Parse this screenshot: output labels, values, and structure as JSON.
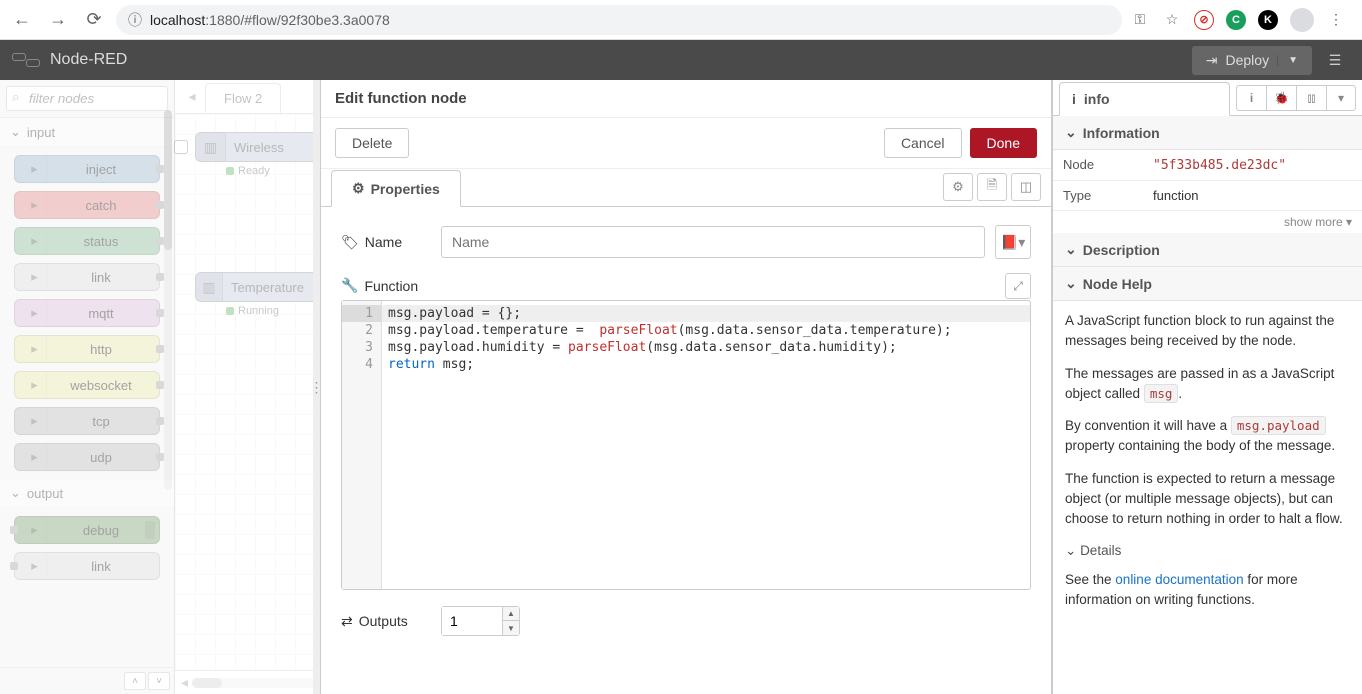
{
  "browser": {
    "url_prefix": "ⓘ",
    "url_host": "localhost",
    "url_port": ":1880",
    "url_path": "/#flow/92f30be3.3a0078",
    "key_icon": "⚿",
    "star_icon": "☆"
  },
  "header": {
    "app_name": "Node-RED",
    "deploy_label": "Deploy"
  },
  "palette": {
    "filter_placeholder": "filter nodes",
    "cat_input": "input",
    "cat_output": "output",
    "nodes_input": [
      {
        "label": "inject",
        "cls": "pn-inject"
      },
      {
        "label": "catch",
        "cls": "pn-catch"
      },
      {
        "label": "status",
        "cls": "pn-status"
      },
      {
        "label": "link",
        "cls": "pn-link"
      },
      {
        "label": "mqtt",
        "cls": "pn-mqtt"
      },
      {
        "label": "http",
        "cls": "pn-http"
      },
      {
        "label": "websocket",
        "cls": "pn-ws"
      },
      {
        "label": "tcp",
        "cls": "pn-tcp"
      },
      {
        "label": "udp",
        "cls": "pn-udp"
      }
    ],
    "nodes_output": [
      {
        "label": "debug",
        "cls": "pn-debug"
      },
      {
        "label": "link",
        "cls": "pn-link"
      }
    ]
  },
  "workspace": {
    "tab_label": "Flow 2",
    "node1_label": "Wireless",
    "node1_status": "Ready",
    "node2_label": "Temperature",
    "node2_status": "Running"
  },
  "editor": {
    "title": "Edit function node",
    "delete_btn": "Delete",
    "cancel_btn": "Cancel",
    "done_btn": "Done",
    "properties_tab": "Properties",
    "name_label": "Name",
    "name_placeholder": "Name",
    "function_label": "Function",
    "outputs_label": "Outputs",
    "outputs_value": "1",
    "code": {
      "lines": [
        "1",
        "2",
        "3",
        "4"
      ],
      "l1a": "msg.payload = {};",
      "l2a": "msg.payload.temperature =  ",
      "l2b": "parseFloat",
      "l2c": "(msg.data.sensor_data.temperature);",
      "l3a": "msg.payload.humidity = ",
      "l3b": "parseFloat",
      "l3c": "(msg.data.sensor_data.humidity);",
      "l4a": "return",
      "l4b": " msg;"
    }
  },
  "sidebar": {
    "tab_label": "info",
    "section_information": "Information",
    "node_row_label": "Node",
    "node_id": "\"5f33b485.de23dc\"",
    "type_row_label": "Type",
    "type_value": "function",
    "show_more": "show more ▾",
    "section_description": "Description",
    "section_nodehelp": "Node Help",
    "help_p1": "A JavaScript function block to run against the messages being received by the node.",
    "help_p2a": "The messages are passed in as a JavaScript object called ",
    "help_p2_code": "msg",
    "help_p2b": ".",
    "help_p3a": "By convention it will have a ",
    "help_p3_code": "msg.payload",
    "help_p3b": " property containing the body of the message.",
    "help_p4": "The function is expected to return a message object (or multiple message objects), but can choose to return nothing in order to halt a flow.",
    "details_label": "Details",
    "help_p5a": "See the ",
    "help_p5_link": "online documentation",
    "help_p5b": " for more information on writing functions."
  }
}
